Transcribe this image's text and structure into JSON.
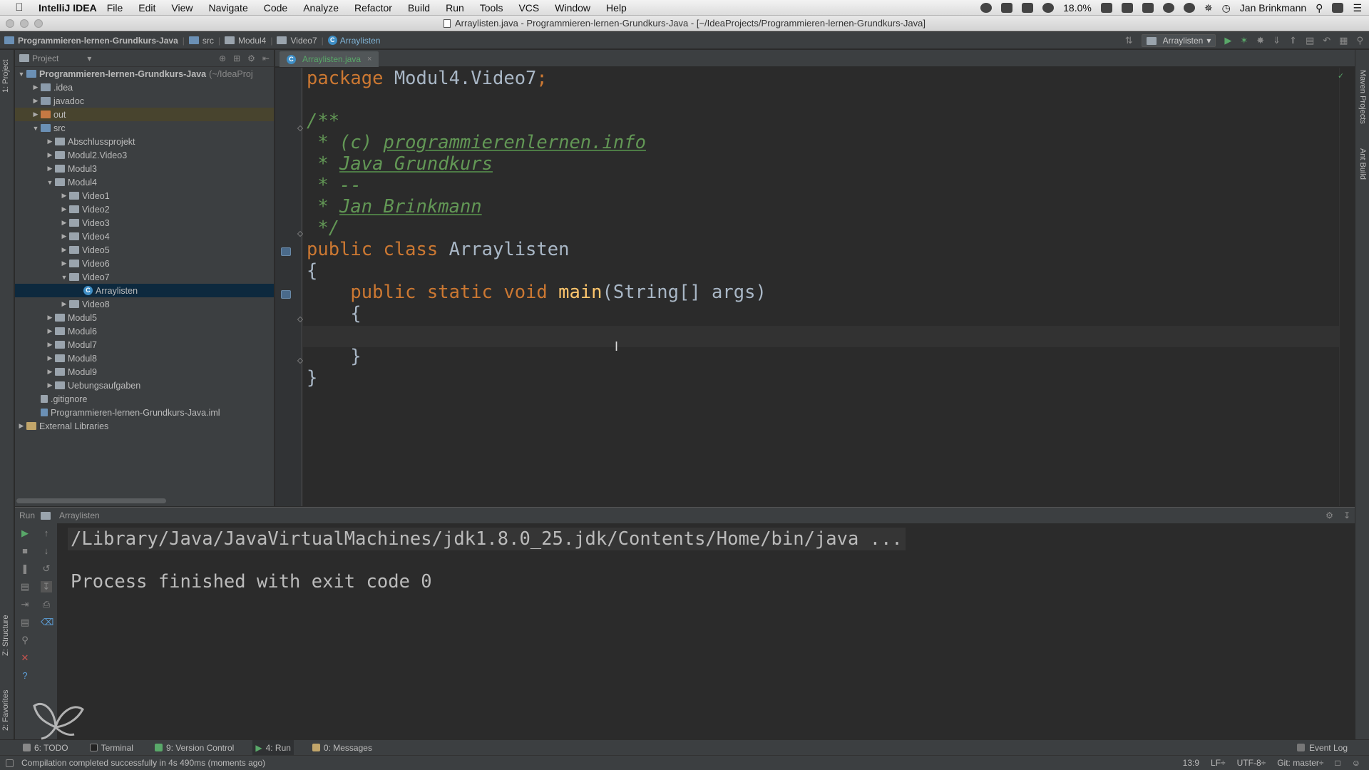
{
  "menubar": {
    "app_name": "IntelliJ IDEA",
    "items": [
      "File",
      "Edit",
      "View",
      "Navigate",
      "Code",
      "Analyze",
      "Refactor",
      "Build",
      "Run",
      "Tools",
      "VCS",
      "Window",
      "Help"
    ],
    "battery": "18.0%",
    "user": "Jan Brinkmann"
  },
  "titlebar": {
    "title": "Arraylisten.java - Programmieren-lernen-Grundkurs-Java - [~/IdeaProjects/Programmieren-lernen-Grundkurs-Java]"
  },
  "navbar": {
    "crumbs": [
      "Programmieren-lernen-Grundkurs-Java",
      "src",
      "Modul4",
      "Video7",
      "Arraylisten"
    ],
    "run_config": "Arraylisten"
  },
  "left_stripe": {
    "project_label": "1: Project",
    "structure_label": "Z: Structure",
    "favorites_label": "2: Favorites"
  },
  "right_stripe": {
    "maven_label": "Maven Projects",
    "ant_label": "Ant Build"
  },
  "project_panel": {
    "header": "Project",
    "root": "Programmieren-lernen-Grundkurs-Java",
    "root_path": "(~/IdeaProj",
    "tree": {
      "idea": ".idea",
      "javadoc": "javadoc",
      "out": "out",
      "src": "src",
      "abschluss": "Abschlussprojekt",
      "modul2": "Modul2.Video3",
      "modul3": "Modul3",
      "modul4": "Modul4",
      "v1": "Video1",
      "v2": "Video2",
      "v3": "Video3",
      "v4": "Video4",
      "v5": "Video5",
      "v6": "Video6",
      "v7": "Video7",
      "arraylisten": "Arraylisten",
      "v8": "Video8",
      "modul5": "Modul5",
      "modul6": "Modul6",
      "modul7": "Modul7",
      "modul8": "Modul8",
      "modul9": "Modul9",
      "uebung": "Uebungsaufgaben",
      "gitignore": ".gitignore",
      "iml": "Programmieren-lernen-Grundkurs-Java.iml",
      "ext": "External Libraries"
    }
  },
  "editor": {
    "tab_label": "Arraylisten.java",
    "code": {
      "l1_kw": "package",
      "l1_rest": " Modul4.Video7",
      "l1_semi": ";",
      "l2": "/**",
      "l3_pre": " * (c) ",
      "l3_link": "programmierenlernen.info",
      "l4_pre": " * ",
      "l4_link": "Java Grundkurs",
      "l5": " * --",
      "l6_pre": " * ",
      "l6_link": "Jan Brinkmann",
      "l7": " */",
      "l8_kw": "public class",
      "l8_name": " Arraylisten",
      "l9": "{",
      "l10_kw": "    public static void",
      "l10_fn": " main",
      "l10_rest": "(String[] args)",
      "l11": "    {",
      "l13": "    }",
      "l14": "}"
    }
  },
  "run_panel": {
    "label": "Run",
    "config": "Arraylisten",
    "command": "/Library/Java/JavaVirtualMachines/jdk1.8.0_25.jdk/Contents/Home/bin/java ...",
    "output": "Process finished with exit code 0"
  },
  "tool_bar": {
    "todo": "6: TODO",
    "terminal": "Terminal",
    "vcs": "9: Version Control",
    "run": "4: Run",
    "messages": "0: Messages",
    "event_log": "Event Log"
  },
  "status_bar": {
    "message": "Compilation completed successfully in 4s 490ms (moments ago)",
    "position": "13:9",
    "line_sep": "LF÷",
    "encoding": "UTF-8÷",
    "git": "Git: master÷"
  },
  "colors": {
    "keyword": "#cc7832",
    "comment": "#629755",
    "function": "#ffc66d",
    "text": "#a9b7c6",
    "background": "#2b2b2b",
    "panel": "#3c3f41"
  }
}
